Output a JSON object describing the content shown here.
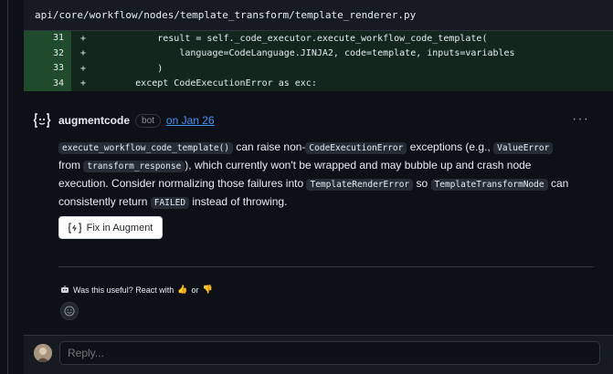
{
  "file_header": {
    "path": "api/core/workflow/nodes/template_transform/template_renderer.py"
  },
  "diff_lines": [
    {
      "num": "31",
      "marker": "+",
      "code": "            result = self._code_executor.execute_workflow_code_template("
    },
    {
      "num": "32",
      "marker": "+",
      "code": "                language=CodeLanguage.JINJA2, code=template, inputs=variables"
    },
    {
      "num": "33",
      "marker": "+",
      "code": "            )"
    },
    {
      "num": "34",
      "marker": "+",
      "code": "        except CodeExecutionError as exc:"
    }
  ],
  "comment": {
    "author": "augmentcode",
    "badge": "bot",
    "date": "on Jan 26",
    "body": {
      "code1": "execute_workflow_code_template()",
      "t1": " can raise non-",
      "code2": "CodeExecutionError",
      "t2": " exceptions (e.g., ",
      "code3": "ValueError",
      "t3": " from ",
      "code4": "transform_response",
      "t4": "), which currently won't be wrapped and may bubble up and crash node execution. Consider normalizing those failures into ",
      "code5": "TemplateRenderError",
      "t5": " so ",
      "code6": "TemplateTransformNode",
      "t6": " can consistently return ",
      "code7": "FAILED",
      "t7": " instead of throwing."
    },
    "fix_button": "Fix in Augment",
    "useful_prompt": "Was this useful? React with",
    "useful_or": "or",
    "more_label": "···"
  },
  "reply": {
    "placeholder": "Reply..."
  },
  "icons": {
    "bot_avatar": "augment-logo-icon",
    "fix": "augment-fix-icon",
    "robot": "robot-icon",
    "thumbs_up": "thumbs-up-icon",
    "thumbs_down": "thumbs-down-icon",
    "smiley": "smiley-icon"
  },
  "colors": {
    "accent_link": "#4493f8",
    "added_bg": "#12261e",
    "added_num_bg": "#1f4a2c"
  }
}
